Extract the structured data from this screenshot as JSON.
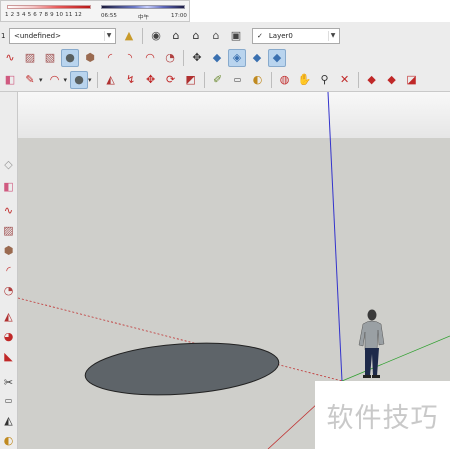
{
  "shadow_settings": {
    "month_ticks": "1 2 3 4 5 6 7 8 9 10 11 12",
    "time_start": "06:55",
    "time_mid": "中午",
    "time_end": "17:00"
  },
  "style_combo": {
    "prefix": "1",
    "value": "<undefined>"
  },
  "layer_combo": {
    "check": "✓",
    "value": "Layer0"
  },
  "watermark": "软件技巧",
  "colors": {
    "sky": "#f2f2f2",
    "ground": "#cfcfcb",
    "disc": "#5e6469",
    "blue_axis": "#3333cc",
    "red_axis": "#c03030",
    "green_axis": "#30a030"
  },
  "icons": {
    "row1": [
      "paint-bucket-icon",
      "glasses-icon",
      "house-icon",
      "house-front-icon",
      "house-outline-icon",
      "warehouse-icon"
    ],
    "row2_draw": [
      "freehand-icon",
      "rectangle-icon",
      "rotated-rectangle-icon",
      "circle-icon",
      "polygon-icon",
      "arc-icon",
      "two-point-arc-icon",
      "three-point-arc-icon",
      "pie-icon"
    ],
    "row2_view": [
      "move-icon",
      "iso-cube-icon",
      "top-view-icon",
      "front-view-icon",
      "right-view-icon"
    ],
    "row3": [
      "eraser-icon",
      "pencil-icon",
      "arc-tool-icon",
      "circle-tool-icon",
      "push-pull-icon",
      "follow-me-icon",
      "move-tool-icon",
      "rotate-icon",
      "scale-icon",
      "tape-measure-icon",
      "dimension-icon",
      "paint-icon",
      "orbit-icon",
      "pan-icon",
      "zoom-icon",
      "zoom-extents-icon",
      "warehouse-get-icon",
      "extension-icon",
      "share-icon"
    ]
  }
}
